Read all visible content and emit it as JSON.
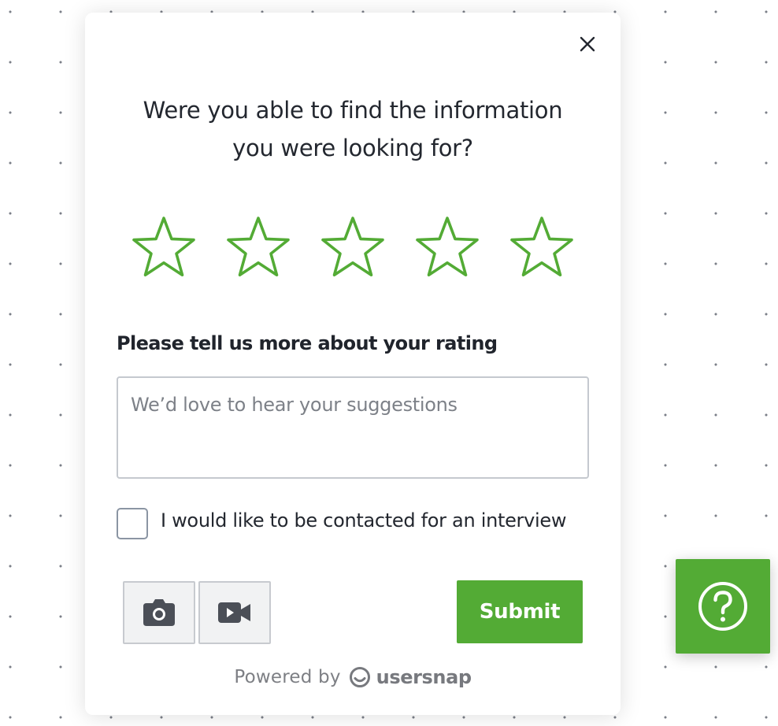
{
  "feedback_widget": {
    "question": "Were you able to find the information you were looking for?",
    "question_line1": "Were you able to find the information",
    "question_line2": "you were looking for?",
    "rating": {
      "max_stars": 5,
      "selected": 0,
      "star_color": "#53ab35",
      "star_labels": [
        "1 star",
        "2 stars",
        "3 stars",
        "4 stars",
        "5 stars"
      ]
    },
    "comment": {
      "label": "Please tell us more about your rating",
      "placeholder": "We’d love to hear your suggestions",
      "value": ""
    },
    "contact_checkbox": {
      "label": "I would like to be contacted for an interview",
      "checked": false
    },
    "tools": {
      "screenshot_icon": "camera-icon",
      "record_icon": "video-camera-icon"
    },
    "submit_label": "Submit",
    "footer": {
      "powered_by": "Powered by",
      "brand": "usersnap",
      "brand_icon": "usersnap-logo-icon"
    },
    "close_icon": "close-icon"
  },
  "help_button": {
    "icon": "question-mark-icon"
  },
  "colors": {
    "accent": "#53ab35",
    "text": "#23272f",
    "placeholder": "#7d8188",
    "background": "#ffffff"
  }
}
